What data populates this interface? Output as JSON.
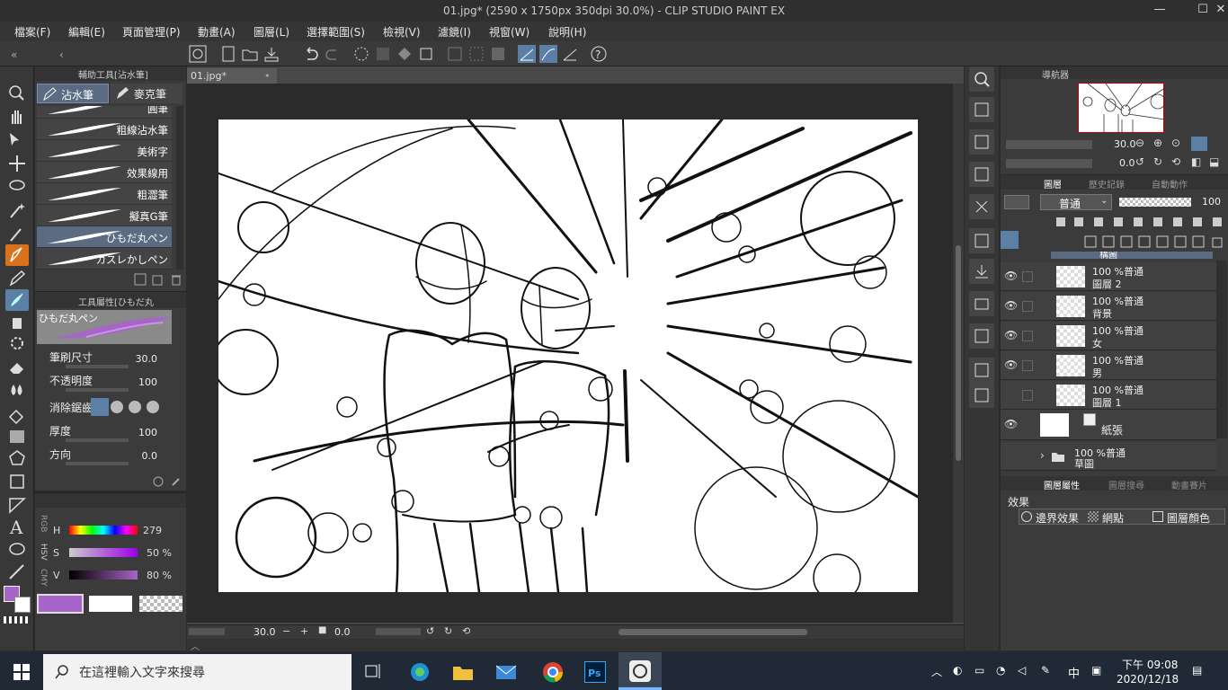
{
  "window": {
    "title": "01.jpg* (2590 x 1750px 350dpi 30.0%) - CLIP STUDIO PAINT EX",
    "minimize": "—",
    "maximize": "☐",
    "close": "✕"
  },
  "menu": [
    "檔案(F)",
    "編輯(E)",
    "頁面管理(P)",
    "動畫(A)",
    "圖層(L)",
    "選擇範圍(S)",
    "檢視(V)",
    "濾鏡(I)",
    "視窗(W)",
    "說明(H)"
  ],
  "subtool": {
    "panel_title": "輔助工具[沾水筆]",
    "tab_active": "沾水筆",
    "tab_other": "麥克筆",
    "brushes": [
      "圓筆",
      "粗線沾水筆",
      "美術字",
      "效果線用",
      "粗澀筆",
      "擬真G筆",
      "ひもだ丸ペン",
      "カスレかしペン"
    ],
    "selected_index": 6
  },
  "toolprop": {
    "panel_title": "工具屬性[ひもだ丸",
    "preview_name": "ひもだ丸ペン",
    "brush_size_label": "筆刷尺寸",
    "brush_size": "30.0",
    "opacity_label": "不透明度",
    "opacity": "100",
    "stabilize_label": "消除鋸齒",
    "thickness_label": "厚度",
    "thickness": "100",
    "direction_label": "方向",
    "direction": "0.0"
  },
  "color": {
    "mode_tabs": [
      "RGB",
      "HSV",
      "CMY"
    ],
    "h_label": "H",
    "h": "279",
    "s_label": "S",
    "s": "50 %",
    "v_label": "V",
    "v": "80 %",
    "main": "#a865c9",
    "secondary": "#ffffff"
  },
  "canvas": {
    "tab": "01.jpg*",
    "zoom": "30.0",
    "angle": "0.0"
  },
  "navigator": {
    "title": "導航器",
    "zoom": "30.0",
    "rotate": "0.0"
  },
  "layers": {
    "tab_layer": "圖層",
    "tab_history": "歷史記錄",
    "tab_auto": "自動動作",
    "blend": "普通",
    "opacity": "100",
    "partial_top": "構圖",
    "items": [
      {
        "pct": "100 %普通",
        "name": "圖層 2"
      },
      {
        "pct": "100 %普通",
        "name": "背景"
      },
      {
        "pct": "100 %普通",
        "name": "女"
      },
      {
        "pct": "100 %普通",
        "name": "男"
      },
      {
        "pct": "100 %普通",
        "name": "圖層 1"
      }
    ],
    "paper": "紙張",
    "folder_pct": "100 %普通",
    "folder_name": "草圖"
  },
  "layerprop": {
    "tab1": "圖層屬性",
    "tab2": "圖層搜尋",
    "tab3": "動畫賽片",
    "effect_label": "效果",
    "border": "邊界效果",
    "screentone": "網點",
    "layer_color": "圖層顏色"
  },
  "taskbar": {
    "search_placeholder": "在這裡輸入文字來搜尋",
    "ime": "中",
    "time": "下午 09:08",
    "date": "2020/12/18"
  }
}
